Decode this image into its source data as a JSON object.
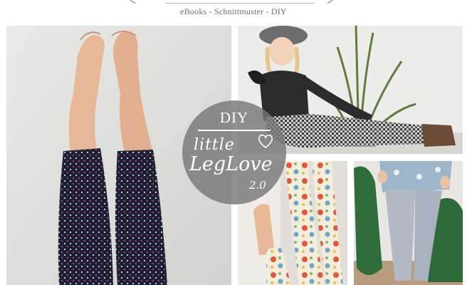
{
  "header": {
    "tagline": "eBooks - Schnittmuster - DIY"
  },
  "badge": {
    "diy": "DIY",
    "line1": "little",
    "line2": "LegLove",
    "line3": "2.0"
  },
  "colors": {
    "badge": "#787878",
    "navy": "#1c2236",
    "floral_bg": "#f3eedc"
  },
  "icons": {
    "heart": "heart-icon"
  }
}
